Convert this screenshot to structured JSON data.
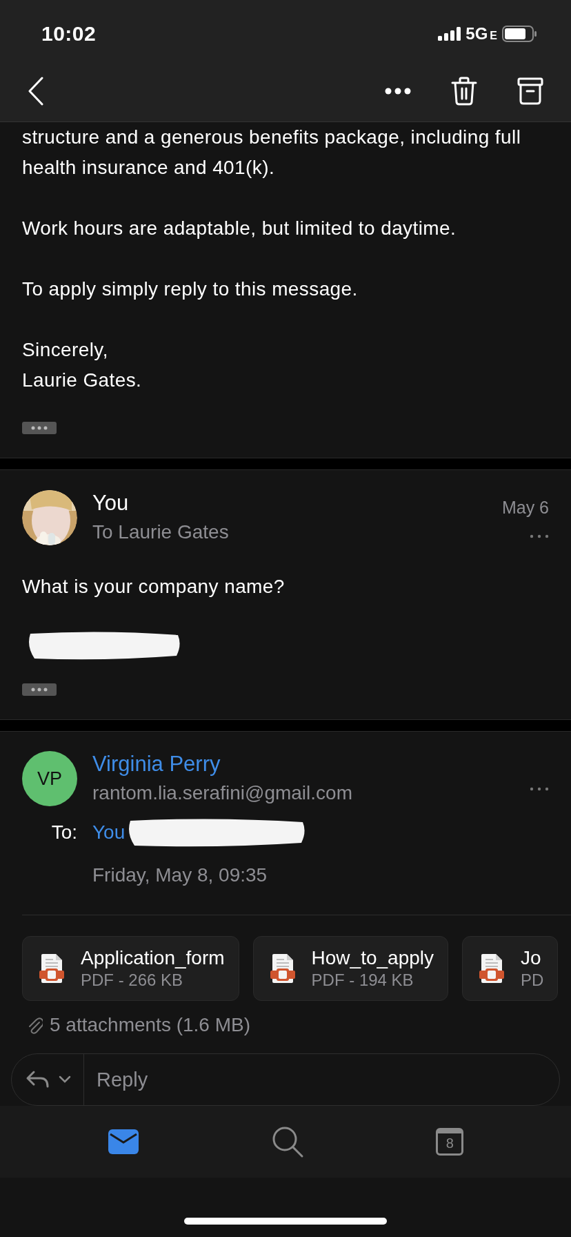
{
  "status_bar": {
    "time": "10:02",
    "network": "5G",
    "network_suffix": "E"
  },
  "messages": [
    {
      "kind": "continuation",
      "paragraphs": [
        [
          "structure and a generous benefits package, including full health insurance and 401(k)."
        ],
        [
          "Work hours are adaptable, but limited to daytime."
        ],
        [
          "To apply simply reply to this message."
        ],
        [
          "Sincerely,",
          "Laurie Gates."
        ]
      ],
      "collapsed_quote": true
    },
    {
      "kind": "sent",
      "avatar": {
        "kind": "picture"
      },
      "sender": "You",
      "recipients": "To Laurie Gates",
      "date": "May 6",
      "paragraphs": [
        [
          "What is your company name?"
        ]
      ],
      "signature_redacted": true,
      "collapsed_quote": true
    },
    {
      "kind": "received",
      "avatar": {
        "kind": "initials",
        "initials": "VP"
      },
      "sender": "Virginia Perry",
      "email": "rantom.lia.serafini@gmail.com",
      "to_label": "To:",
      "to": "You",
      "to_redacted": true,
      "date": "Friday, May 8, 09:35",
      "attachments": [
        {
          "name": "Application_form",
          "meta": "PDF - 266 KB"
        },
        {
          "name": "How_to_apply",
          "meta": "PDF - 194 KB"
        },
        {
          "name": "Jo",
          "meta": "PD"
        }
      ],
      "attachments_summary": "5 attachments (1.6 MB)"
    }
  ],
  "reply_bar": {
    "placeholder": "Reply"
  },
  "tab_bar": [
    {
      "kind": "mail",
      "selected": true
    },
    {
      "kind": "search",
      "selected": false
    },
    {
      "kind": "calendar",
      "selected": false,
      "day": "8"
    }
  ]
}
